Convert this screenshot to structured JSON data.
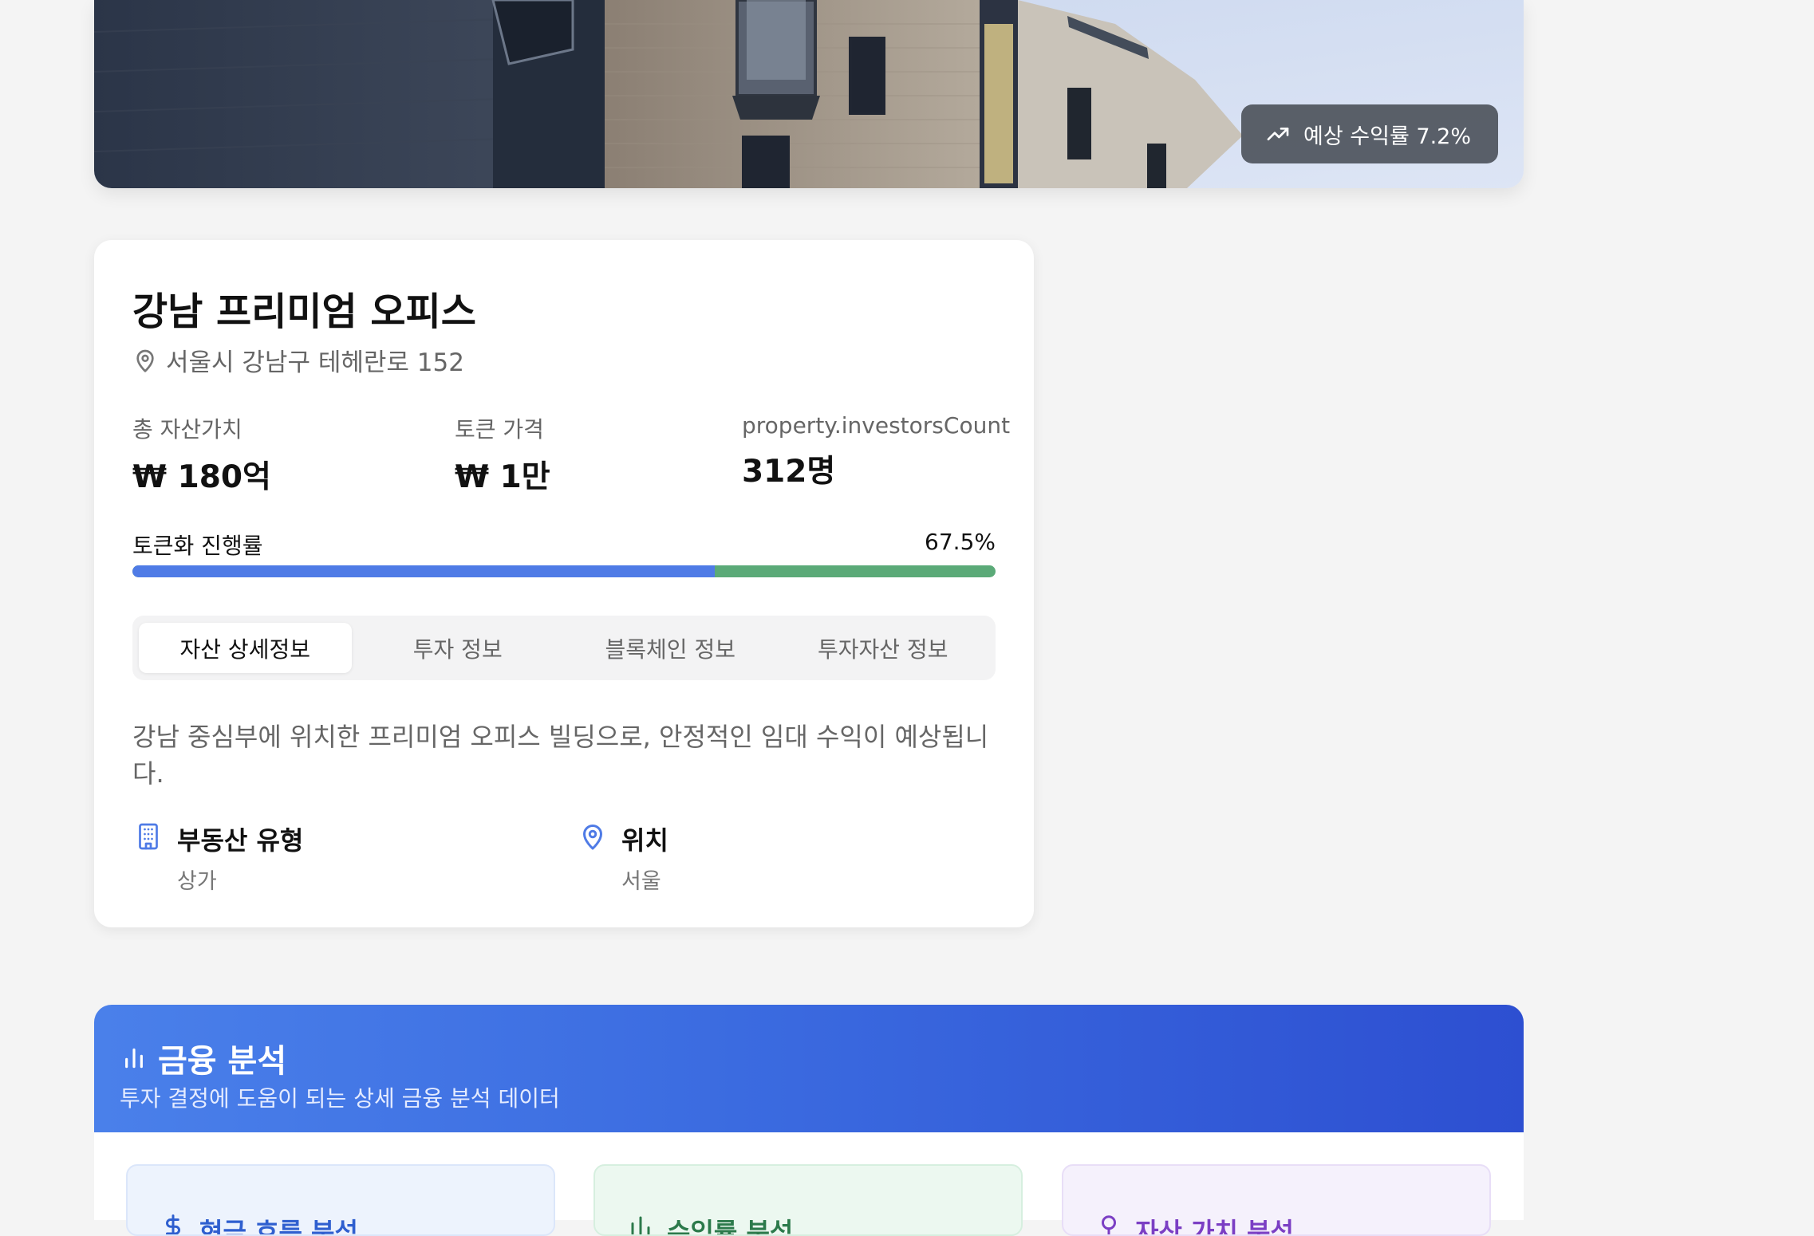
{
  "hero": {
    "yield_badge": "예상 수익률 7.2%"
  },
  "property": {
    "title": "강남 프리미엄 오피스",
    "address": "서울시 강남구 테헤란로 152",
    "stats": [
      {
        "label": "총 자산가치",
        "value": "₩ 180억"
      },
      {
        "label": "토큰 가격",
        "value": "₩ 1만"
      },
      {
        "label": "property.investorsCount",
        "value": "312명"
      }
    ],
    "progress": {
      "label": "토큰화 진행률",
      "value_text": "67.5%",
      "value": 0.675,
      "fill_color": "#4f7be6",
      "track_color": "#5baa78"
    },
    "tabs": [
      {
        "label": "자산 상세정보",
        "active": true
      },
      {
        "label": "투자 정보",
        "active": false
      },
      {
        "label": "블록체인 정보",
        "active": false
      },
      {
        "label": "투자자산 정보",
        "active": false
      }
    ],
    "description": "강남 중심부에 위치한 프리미엄 오피스 빌딩으로, 안정적인 임대 수익이 예상됩니다.",
    "info": [
      {
        "icon": "building-icon",
        "title": "부동산 유형",
        "value": "상가"
      },
      {
        "icon": "map-pin-icon",
        "title": "위치",
        "value": "서울"
      }
    ]
  },
  "financial": {
    "title": "금융 분석",
    "subtitle": "투자 결정에 도움이 되는 상세 금융 분석 데이터",
    "cards": [
      {
        "label": "현금 흐름 분석",
        "icon": "cash-flow-icon"
      },
      {
        "label": "수익률 분석",
        "icon": "chart-icon"
      },
      {
        "label": "자산 가치 분석",
        "icon": "value-icon"
      }
    ]
  }
}
